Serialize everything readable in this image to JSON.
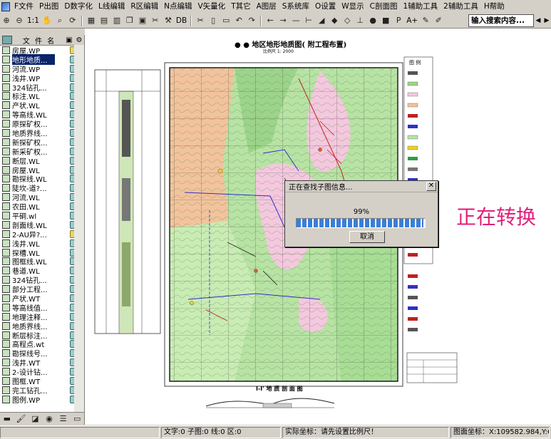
{
  "menubar": {
    "items": [
      "F文件",
      "P出图",
      "D数字化",
      "L线编辑",
      "R区编辑",
      "N点编辑",
      "V矢量化",
      "T其它",
      "A图层",
      "S系统库",
      "O设置",
      "W显示",
      "C剖面图",
      "1辅助工具",
      "2辅助工具",
      "H帮助"
    ]
  },
  "toolbar": {
    "zoom_ratio_label": "1:1",
    "db_label": "DB",
    "font_label": "A+",
    "search_placeholder": "输入搜索内容..."
  },
  "file_panel": {
    "header_title": "文 件 名",
    "selected_index": 1,
    "files": [
      {
        "name": "房屋.WP",
        "state": "open"
      },
      {
        "name": "地形地质...",
        "state": "closed"
      },
      {
        "name": "河流.WP",
        "state": "closed"
      },
      {
        "name": "浅井.WP",
        "state": "closed"
      },
      {
        "name": "324钻孔...",
        "state": "closed"
      },
      {
        "name": "标注.WL",
        "state": "closed"
      },
      {
        "name": "产状.WL",
        "state": "closed"
      },
      {
        "name": "等高线.WL",
        "state": "closed"
      },
      {
        "name": "原探矿权...",
        "state": "closed"
      },
      {
        "name": "地质界线...",
        "state": "closed"
      },
      {
        "name": "新探矿权...",
        "state": "closed"
      },
      {
        "name": "新采矿权...",
        "state": "closed"
      },
      {
        "name": "断层.WL",
        "state": "closed"
      },
      {
        "name": "房屋.WL",
        "state": "closed"
      },
      {
        "name": "勘探线.WL",
        "state": "closed"
      },
      {
        "name": "陡坎-道?...",
        "state": "closed"
      },
      {
        "name": "河流.WL",
        "state": "closed"
      },
      {
        "name": "农田.WL",
        "state": "closed"
      },
      {
        "name": "平硐.wl",
        "state": "closed"
      },
      {
        "name": "剖面线.WL",
        "state": "closed"
      },
      {
        "name": "2-AU异?...",
        "state": "open"
      },
      {
        "name": "浅井.WL",
        "state": "closed"
      },
      {
        "name": "探槽.WL",
        "state": "closed"
      },
      {
        "name": "图框线.WL",
        "state": "closed"
      },
      {
        "name": "巷道.WL",
        "state": "closed"
      },
      {
        "name": "324钻孔...",
        "state": "closed"
      },
      {
        "name": "部分工程...",
        "state": "closed"
      },
      {
        "name": "产状.WT",
        "state": "closed"
      },
      {
        "name": "等高线值...",
        "state": "closed"
      },
      {
        "name": "地理注释...",
        "state": "closed"
      },
      {
        "name": "地质界线...",
        "state": "closed"
      },
      {
        "name": "断层标注...",
        "state": "closed"
      },
      {
        "name": "高程点.wt",
        "state": "closed"
      },
      {
        "name": "勘探线号...",
        "state": "closed"
      },
      {
        "name": "浅井.WT",
        "state": "closed"
      },
      {
        "name": "2-设计钻...",
        "state": "closed"
      },
      {
        "name": "图框.WT",
        "state": "closed"
      },
      {
        "name": "完工钻孔...",
        "state": "closed"
      },
      {
        "name": "图例.WP",
        "state": "closed"
      }
    ]
  },
  "map": {
    "title": "●  ● 地区地形地质图( 附工程布置)",
    "scale_text": "比例尺  1: 2000",
    "legend_title": "图  例",
    "section_title": "I-I'  地  质  剖  面  图"
  },
  "dialog": {
    "title": "正在查找子图信息...",
    "percent_text": "99%",
    "progress": 0.99,
    "cancel_label": "取消"
  },
  "overlay": {
    "converting_text": "正在转换"
  },
  "statusbar": {
    "counts": "文字:0 子图:0 线:0 区:0",
    "actual_coords": "实际坐标：请先设置比例尺！",
    "map_coords": "图面坐标：X:109582.984,Y:673560.803"
  },
  "colors": {
    "map_green": "#9bd48a",
    "map_pink": "#f4c8de",
    "map_orange": "#f2c39c",
    "progress_blue": "#3a7ed8",
    "converting_magenta": "#e0207a"
  }
}
